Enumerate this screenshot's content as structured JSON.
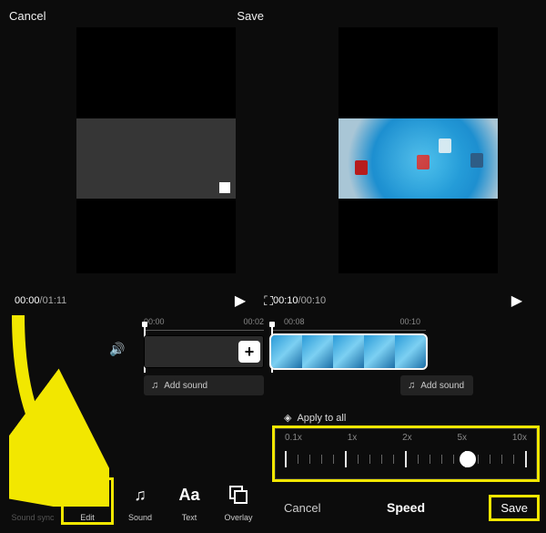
{
  "left": {
    "header": {
      "cancel": "Cancel",
      "save": "Save"
    },
    "time": {
      "current": "00:00",
      "total": "01:11"
    },
    "ruler": {
      "t0": "00:00",
      "t1": "00:02"
    },
    "addSound": "Add sound",
    "tools": {
      "soundSync": "Sound sync",
      "edit": "Edit",
      "sound": "Sound",
      "text": "Text",
      "overlay": "Overlay"
    }
  },
  "right": {
    "time": {
      "current": "00:10",
      "total": "00:10"
    },
    "ruler": {
      "t0": "00:08",
      "t1": "00:10"
    },
    "addSound": "Add sound",
    "applyAll": "Apply to all",
    "speedPanel": {
      "labels": [
        "0.1x",
        "1x",
        "2x",
        "5x",
        "10x"
      ],
      "knob": 0.72
    },
    "footer": {
      "cancel": "Cancel",
      "title": "Speed",
      "save": "Save"
    }
  },
  "icons": {
    "play": "▶",
    "fullscreen": "⛶",
    "volume": "🔊",
    "note": "♫",
    "plus": "+",
    "layers": "◈",
    "sync": "⟳",
    "edit": "〔▸〕",
    "text": "Aa",
    "overlay": "▣"
  },
  "arrowColor": "#f2e700"
}
